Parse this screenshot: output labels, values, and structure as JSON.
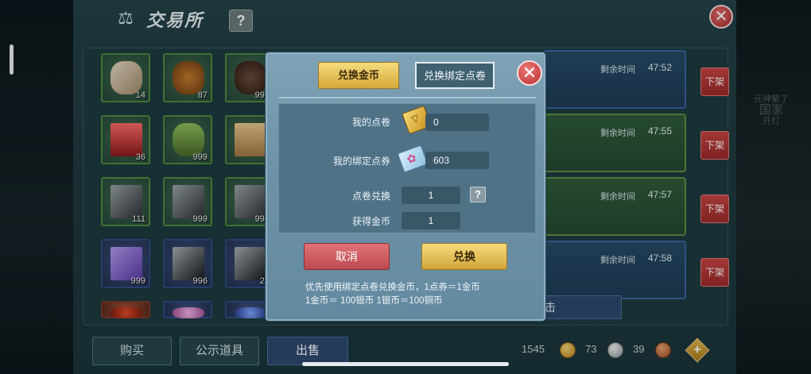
{
  "window": {
    "title": "交易所",
    "help_icon": "?",
    "close_icon": "✕"
  },
  "side_right_ghost": {
    "line1": "元神紫了",
    "line2": "国家",
    "line3": "开灯"
  },
  "inventory": [
    {
      "count": "14",
      "kind": "horn",
      "frame": "green"
    },
    {
      "count": "87",
      "kind": "stump",
      "frame": "green"
    },
    {
      "count": "999",
      "kind": "ore-dark",
      "frame": "green"
    },
    {
      "count": "36",
      "kind": "red-crystal",
      "frame": "green"
    },
    {
      "count": "999",
      "kind": "sapling",
      "frame": "green"
    },
    {
      "count": "",
      "kind": "pyramid",
      "frame": "green"
    },
    {
      "count": "111",
      "kind": "dark-crystal",
      "frame": "green"
    },
    {
      "count": "999",
      "kind": "dark-crystal",
      "frame": "green"
    },
    {
      "count": "999",
      "kind": "dark-crystal",
      "frame": "green"
    },
    {
      "count": "999",
      "kind": "purple-crystal",
      "frame": "purple"
    },
    {
      "count": "996",
      "kind": "black-crystal",
      "frame": "purple"
    },
    {
      "count": "26",
      "kind": "black-crystal",
      "frame": "purple"
    },
    {
      "count": "",
      "kind": "red-item",
      "frame": "red"
    },
    {
      "count": "",
      "kind": "pink-orb",
      "frame": "purple"
    },
    {
      "count": "",
      "kind": "blue-gem",
      "frame": "purple"
    }
  ],
  "listings": [
    {
      "remaining_label": "剩余时间",
      "remaining_value": "47:52",
      "action": "下架",
      "frame": "blue"
    },
    {
      "remaining_label": "剩余时间",
      "remaining_value": "47:55",
      "action": "下架",
      "frame": "green"
    },
    {
      "remaining_label": "剩余时间",
      "remaining_value": "47:57",
      "action": "下架",
      "frame": "green"
    },
    {
      "remaining_label": "剩余时间",
      "remaining_value": "47:58",
      "action": "下架",
      "frame": "blue"
    }
  ],
  "bottom_tabs": [
    {
      "label": "购买",
      "active": false
    },
    {
      "label": "公示道具",
      "active": false
    },
    {
      "label": "出售",
      "active": true
    }
  ],
  "bottom_partial_button": "击",
  "currency": {
    "points": "1545",
    "gold": "73",
    "silver": "39",
    "plus_icon": "+"
  },
  "modal": {
    "tabs": [
      {
        "label": "兑换金币",
        "active": true
      },
      {
        "label": "兑换绑定点卷",
        "active": false
      }
    ],
    "close_icon": "✕",
    "my_points_label": "我的点卷",
    "my_points_value": "0",
    "my_bound_points_label": "我的绑定点券",
    "my_bound_points_value": "603",
    "exchange_label": "点卷兑换",
    "exchange_value": "1",
    "exchange_help_icon": "?",
    "gain_gold_label": "获得金币",
    "gain_gold_value": "1",
    "cancel_label": "取消",
    "confirm_label": "兑换",
    "note_line1": "优先使用绑定点卷兑换金币，1点券＝1金币",
    "note_line2": "1金币＝ 100银币   1银币＝100铜币"
  },
  "colors": {
    "gold_button": "#e0b446",
    "cancel_button": "#d05a62",
    "close_red": "#c0393b",
    "modal_bg": "#6f94a9",
    "panel_bg": "#4f7287"
  }
}
